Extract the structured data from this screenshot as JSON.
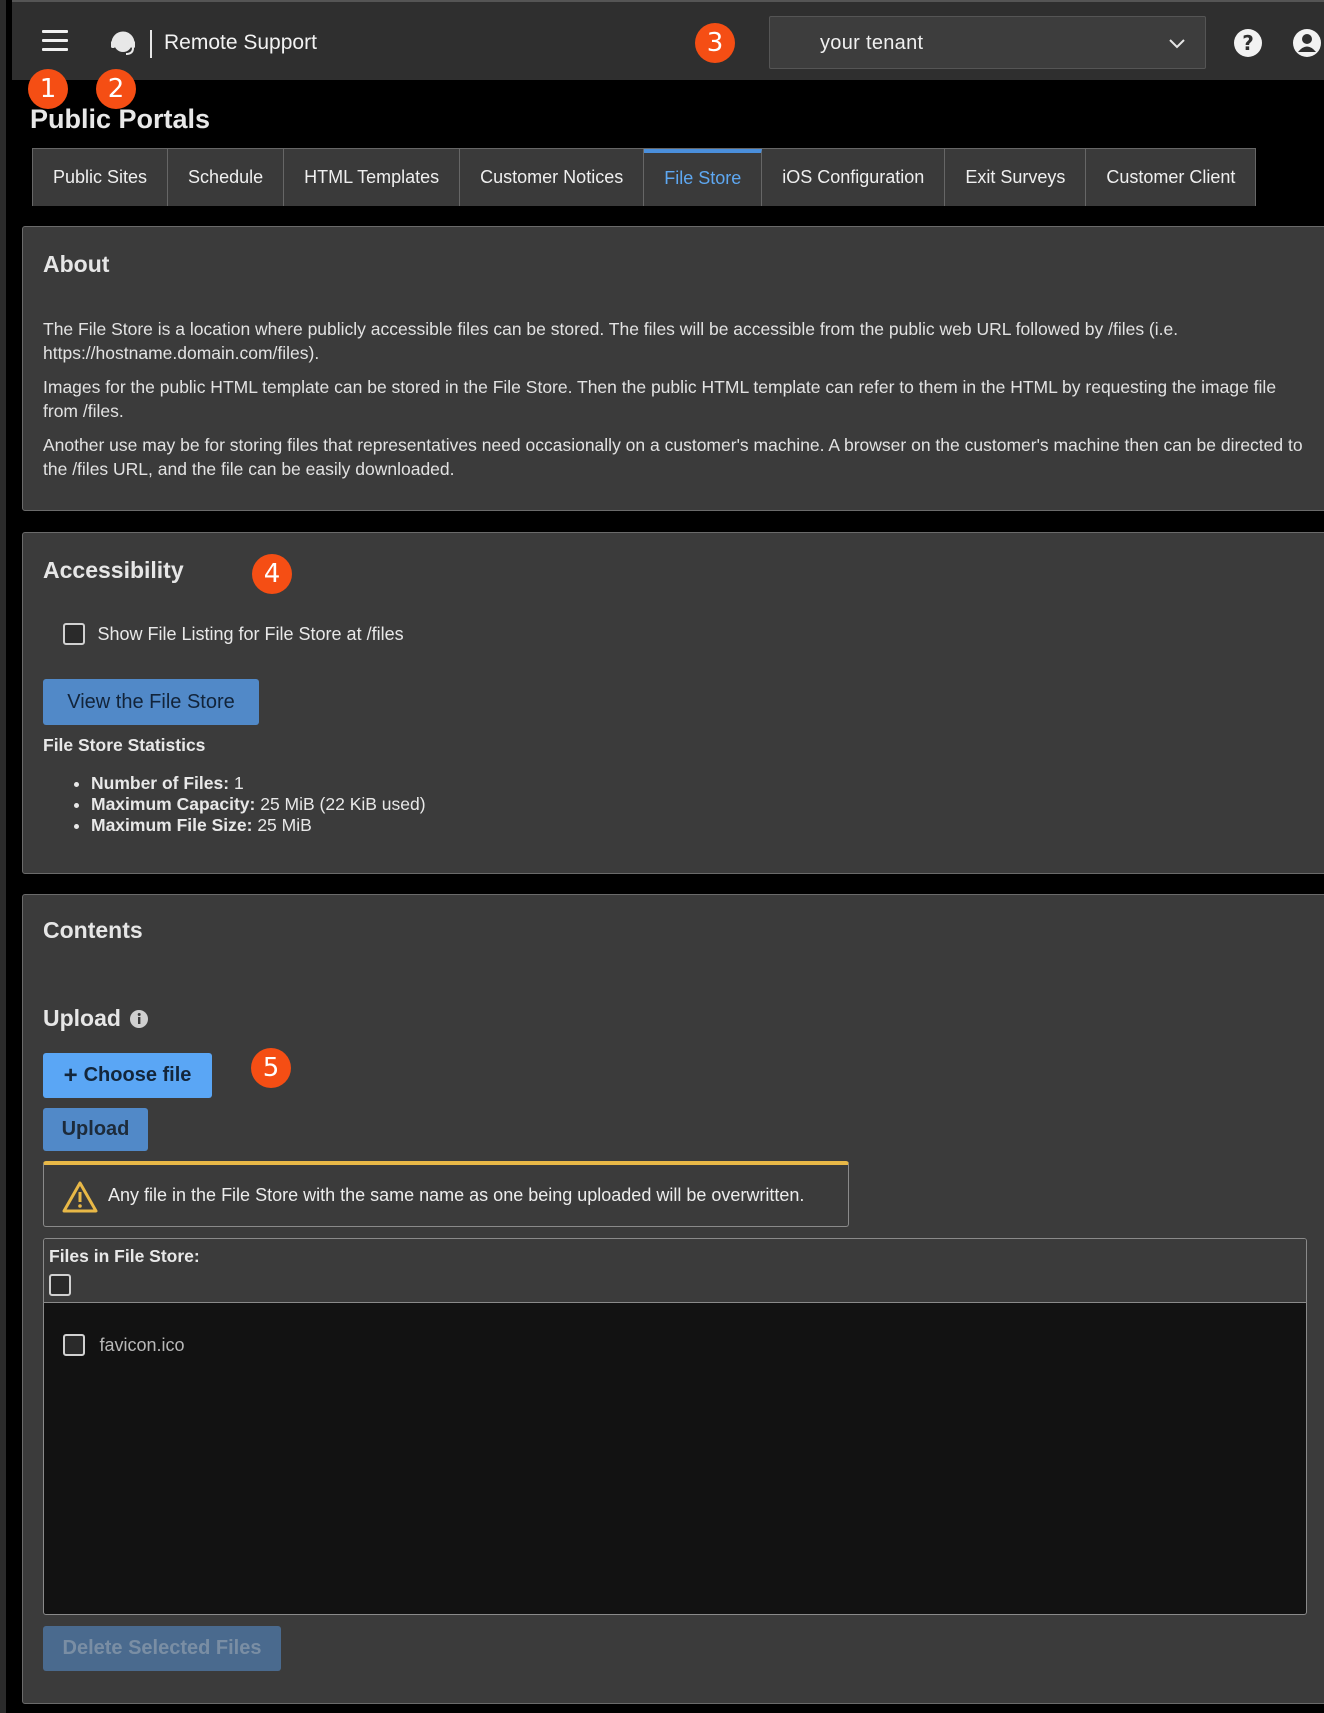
{
  "header": {
    "brand": "Remote Support",
    "tenant": "your tenant",
    "badges": [
      "1",
      "2",
      "3",
      "4",
      "5"
    ]
  },
  "page": {
    "title": "Public Portals"
  },
  "tabs": [
    {
      "label": "Public Sites"
    },
    {
      "label": "Schedule"
    },
    {
      "label": "HTML Templates"
    },
    {
      "label": "Customer Notices"
    },
    {
      "label": "File Store",
      "active": true
    },
    {
      "label": "iOS Configuration"
    },
    {
      "label": "Exit Surveys"
    },
    {
      "label": "Customer Client"
    }
  ],
  "about": {
    "title": "About",
    "p1": "The File Store is a location where publicly accessible files can be stored. The files will be accessible from the public web URL followed by /files (i.e. https://hostname.domain.com/files).",
    "p2": "Images for the public HTML template can be stored in the File Store. Then the public HTML template can refer to them in the HTML by requesting the image file from /files.",
    "p3": "Another use may be for storing files that representatives need occasionally on a customer's machine. A browser on the customer's machine then can be directed to the /files URL, and the file can be easily downloaded."
  },
  "accessibility": {
    "title": "Accessibility",
    "checkbox_label": "Show File Listing for File Store at /files",
    "view_button": "View the File Store",
    "stats_title": "File Store Statistics",
    "stats": [
      {
        "label": "Number of Files:",
        "value": "1"
      },
      {
        "label": "Maximum Capacity:",
        "value": "25 MiB (22 KiB used)"
      },
      {
        "label": "Maximum File Size:",
        "value": "25 MiB"
      }
    ]
  },
  "contents": {
    "title": "Contents",
    "upload_title": "Upload",
    "choose_file": "Choose file",
    "upload_button": "Upload",
    "warning": "Any file in the File Store with the same name as one being uploaded will be overwritten.",
    "files_label": "Files in File Store:",
    "files": [
      "favicon.ico"
    ],
    "delete_button": "Delete Selected Files"
  },
  "colors": {
    "accent": "#5aa6f5",
    "badge": "#f54e14",
    "warning": "#e8b847"
  }
}
